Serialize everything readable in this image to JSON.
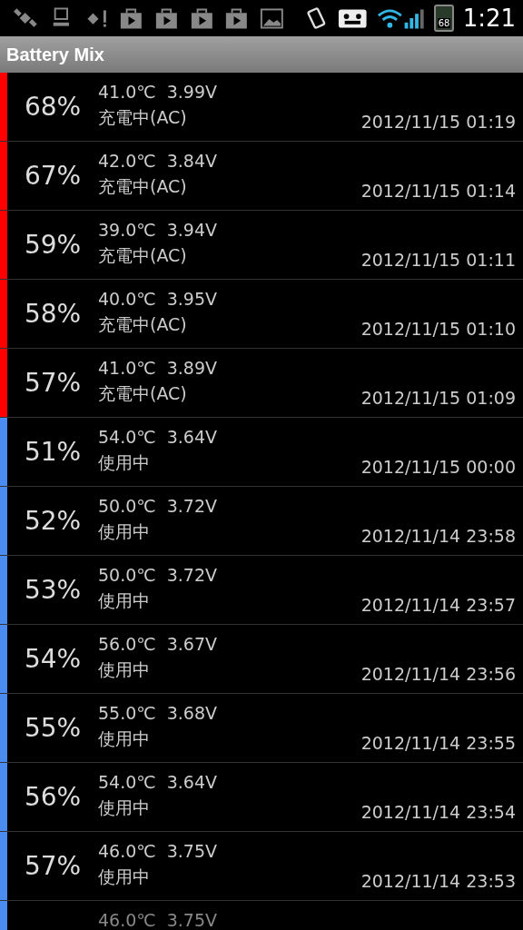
{
  "status_bar": {
    "battery_text": "68",
    "time": "1:21"
  },
  "title_bar": {
    "title": "Battery Mix"
  },
  "rows": [
    {
      "percent": "68%",
      "reading": "41.0℃  3.99V",
      "status": "充電中(AC)",
      "timestamp": "2012/11/15 01:19",
      "color": "#ff0000"
    },
    {
      "percent": "67%",
      "reading": "42.0℃  3.84V",
      "status": "充電中(AC)",
      "timestamp": "2012/11/15 01:14",
      "color": "#ff0000"
    },
    {
      "percent": "59%",
      "reading": "39.0℃  3.94V",
      "status": "充電中(AC)",
      "timestamp": "2012/11/15 01:11",
      "color": "#ff0000"
    },
    {
      "percent": "58%",
      "reading": "40.0℃  3.95V",
      "status": "充電中(AC)",
      "timestamp": "2012/11/15 01:10",
      "color": "#ff0000"
    },
    {
      "percent": "57%",
      "reading": "41.0℃  3.89V",
      "status": "充電中(AC)",
      "timestamp": "2012/11/15 01:09",
      "color": "#ff0000"
    },
    {
      "percent": "51%",
      "reading": "54.0℃  3.64V",
      "status": "使用中",
      "timestamp": "2012/11/15 00:00",
      "color": "#4a8cf0"
    },
    {
      "percent": "52%",
      "reading": "50.0℃  3.72V",
      "status": "使用中",
      "timestamp": "2012/11/14 23:58",
      "color": "#4a8cf0"
    },
    {
      "percent": "53%",
      "reading": "50.0℃  3.72V",
      "status": "使用中",
      "timestamp": "2012/11/14 23:57",
      "color": "#4a8cf0"
    },
    {
      "percent": "54%",
      "reading": "56.0℃  3.67V",
      "status": "使用中",
      "timestamp": "2012/11/14 23:56",
      "color": "#4a8cf0"
    },
    {
      "percent": "55%",
      "reading": "55.0℃  3.68V",
      "status": "使用中",
      "timestamp": "2012/11/14 23:55",
      "color": "#4a8cf0"
    },
    {
      "percent": "56%",
      "reading": "54.0℃  3.64V",
      "status": "使用中",
      "timestamp": "2012/11/14 23:54",
      "color": "#4a8cf0"
    },
    {
      "percent": "57%",
      "reading": "46.0℃  3.75V",
      "status": "使用中",
      "timestamp": "2012/11/14 23:53",
      "color": "#4a8cf0"
    },
    {
      "reading": "46.0℃  3.75V",
      "color": "#4a8cf0"
    }
  ]
}
